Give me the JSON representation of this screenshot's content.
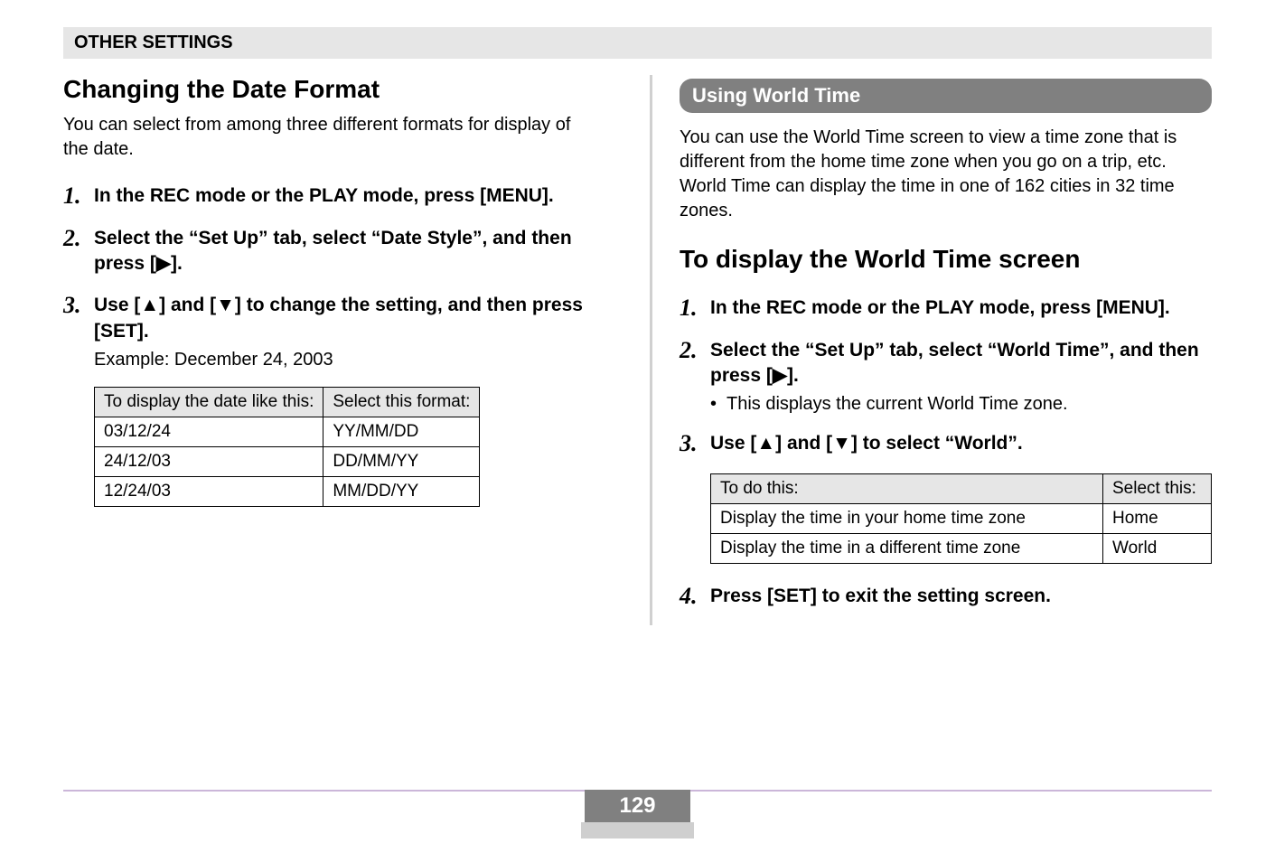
{
  "header": {
    "title": "OTHER SETTINGS"
  },
  "left": {
    "heading": "Changing the Date Format",
    "intro": "You can select from among three different formats for display of the date.",
    "steps": [
      {
        "num": "1.",
        "text": "In the REC mode or the PLAY mode, press [MENU]."
      },
      {
        "num": "2.",
        "text": "Select the “Set Up” tab, select “Date Style”, and then press [▶]."
      },
      {
        "num": "3.",
        "text": "Use [▲] and [▼] to change the setting, and then press [SET].",
        "sub": "Example: December 24, 2003"
      }
    ],
    "table": {
      "headers": [
        "To display the date like this:",
        "Select this format:"
      ],
      "rows": [
        [
          "03/12/24",
          "YY/MM/DD"
        ],
        [
          "24/12/03",
          "DD/MM/YY"
        ],
        [
          "12/24/03",
          "MM/DD/YY"
        ]
      ]
    }
  },
  "right": {
    "pill": "Using World Time",
    "intro": "You can use the World Time screen to view a time zone that is different from the home time zone when you go on a trip, etc. World Time can display the time in one of 162 cities in 32 time zones.",
    "heading": "To display the World Time screen",
    "steps": [
      {
        "num": "1.",
        "text": "In the REC mode or the PLAY mode, press [MENU]."
      },
      {
        "num": "2.",
        "text": "Select the “Set Up” tab, select “World Time”, and then press [▶].",
        "bullet": "This displays the current World Time zone."
      },
      {
        "num": "3.",
        "text": "Use [▲] and [▼] to select “World”."
      },
      {
        "num": "4.",
        "text": "Press [SET] to exit the setting screen."
      }
    ],
    "table": {
      "headers": [
        "To do this:",
        "Select this:"
      ],
      "rows": [
        [
          "Display the time in your home time zone",
          "Home"
        ],
        [
          "Display the time in a different time zone",
          "World"
        ]
      ]
    }
  },
  "page_number": "129"
}
